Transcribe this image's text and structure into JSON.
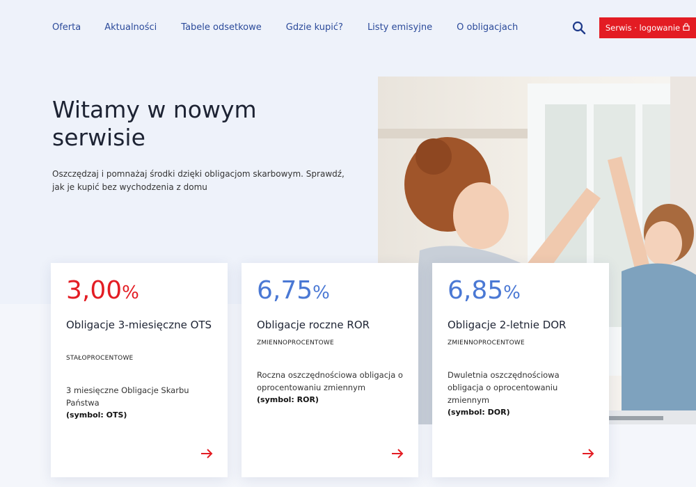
{
  "nav": {
    "items": [
      "Oferta",
      "Aktualności",
      "Tabele odsetkowe",
      "Gdzie kupić?",
      "Listy emisyjne",
      "O obligacjach"
    ],
    "search_icon": "search-icon",
    "login_label": "Serwis · logowanie",
    "login_icon": "lock-icon"
  },
  "hero": {
    "title": "Witamy w nowym serwisie",
    "subtitle": "Oszczędzaj i pomnażaj środki dzięki obligacjom skarbowym. Sprawdź, jak je kupić bez wychodzenia z domu"
  },
  "cards": [
    {
      "rate": "3,00",
      "unit": "%",
      "color": "#e31c23",
      "name": "Obligacje 3-miesięczne OTS",
      "kind": "STAŁOPROCENTOWE",
      "desc": "3 miesięczne Obligacje Skarbu Państwa",
      "symbol": "(symbol: OTS)"
    },
    {
      "rate": "6,75",
      "unit": "%",
      "color": "#4a78d4",
      "name": "Obligacje roczne ROR",
      "kind": "ZMIENNOPROCENTOWE",
      "desc": "Roczna oszczędnościowa obligacja o oprocentowaniu zmiennym",
      "symbol": "(symbol: ROR)"
    },
    {
      "rate": "6,85",
      "unit": "%",
      "color": "#4a78d4",
      "name": "Obligacje 2-letnie DOR",
      "kind": "ZMIENNOPROCENTOWE",
      "desc": "Dwuletnia oszczędnościowa obligacja o oprocentowaniu zmiennym",
      "symbol": "(symbol: DOR)"
    }
  ],
  "colors": {
    "accent_red": "#e31c23",
    "nav_blue": "#2b4a9a",
    "rate_blue": "#4a78d4"
  }
}
